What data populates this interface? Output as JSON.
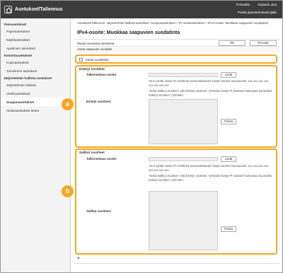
{
  "header": {
    "title": "Asetukset/Tallennus",
    "links": [
      "Portaaliin",
      "Kirjaudu ulos"
    ],
    "link2": "Posita järjestelmävalvojalle"
  },
  "sidebar": {
    "sections": [
      {
        "title": "Yleisasetukset",
        "items": [
          "Paperiasetukset",
          "Näyttöasetukset",
          "Ajastimen asetukset"
        ]
      },
      {
        "title": "Toimintoasetukset",
        "items": [
          "Kopioasetukset",
          "Tulostimen asetukset"
        ]
      },
      {
        "title": "Järjestelmän hallinta-asetukset",
        "items": [
          "Järjestelmän hallinta",
          "Verkkoasetukset",
          "Suojausasetukset",
          "Aloitusasetukset tiedot"
        ]
      }
    ],
    "active": "Suojausasetukset"
  },
  "main": {
    "breadcrumb": "Asetukset/Tallennus: Järjestelmän hallinta-asetukset: Suojausasetukset > IP-osoiteasetukset > IPv4-osoite: Muokkaa saapuvien suodatinta",
    "title": "IPv4-osoite: Muokkaa saapuvien suodatinta",
    "toolbar_text": "Muuta seuraavia asetuksia.",
    "ok_label": "OK",
    "cancel_label": "Peruuta",
    "section_header": "Aseta saapuvan suodatin",
    "enable_filter_label": "Käytä suodatinta",
    "blocked": {
      "title": "Estetyt osoitteet",
      "address_label": "Tallennettava osoite:",
      "add_label": "Lisää",
      "note1": "*Kun syötät useita IP-osoitteita samanaikaisesti, käytä muotoa seuraavasti: xxx.xxx.xxx.xxx-xxx.xxx.xxx.xxx",
      "note2": "*Sekä Sallitut osoitteet- että Estetyt osoitteet -ryhmään lisätyt IP-osoitteet katsotaan kuuluviksi Estetyt osoitteet -ryhmään.",
      "list_label": "Estetyt osoitteet:",
      "delete_label": "Poista"
    },
    "allowed": {
      "title": "Sallitut osoitteet",
      "address_label": "Tallennettava osoite:",
      "add_label": "Lisää",
      "note1": "*Kun syötät useita IP-osoitteita samanaikaisesti, käytä muotoa seuraavasti: xxx.xxx.xxx.xxx-xxx.xxx.xxx.xxx",
      "note2": "*Sekä Sallitut osoitteet- että Estetyt osoitteet -ryhmään lisätyt IP-osoitteet katsotaan kuuluviksi Estetyt osoitteet -ryhmään.",
      "list_label": "Sallitut osoitteet:",
      "delete_label": "Poista"
    },
    "callouts": [
      "a",
      "b"
    ],
    "footnote": "⮝"
  },
  "colors": {
    "accent": "#f5a623",
    "topbar": "#3c3c3c"
  }
}
